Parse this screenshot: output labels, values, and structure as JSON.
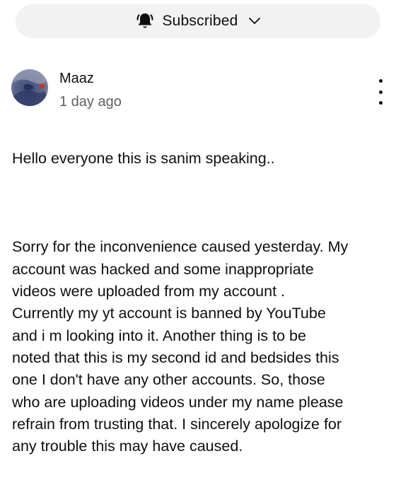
{
  "subscription": {
    "label": "Subscribed",
    "icon": "bell-icon",
    "dropdown_icon": "chevron-down-icon"
  },
  "comment": {
    "author": "Maaz",
    "time": "1 day ago",
    "greeting": "Hello everyone this is sanim speaking..",
    "message": "Sorry for the inconvenience caused yesterday. My\naccount was hacked and some inappropriate\nvideos were uploaded from my account .\nCurrently my yt account is banned by YouTube\nand i m looking into it. Another thing is to be\nnoted that this is my second id and bedsides this\none I don't have any other accounts. So, those\nwho are uploading videos under my name please\nrefrain from trusting that. I sincerely apologize for\nany trouble this may have caused.",
    "menu_icon": "more-vert-icon"
  },
  "colors": {
    "pill_background": "#f2f2f2",
    "secondary_text": "#606060",
    "primary_text": "#0f0f0f"
  }
}
